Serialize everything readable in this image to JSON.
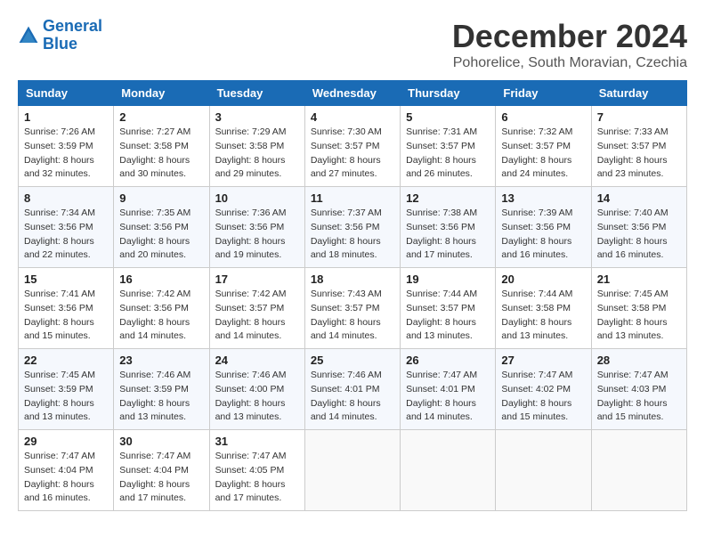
{
  "logo": {
    "line1": "General",
    "line2": "Blue"
  },
  "title": "December 2024",
  "subtitle": "Pohorelice, South Moravian, Czechia",
  "days_of_week": [
    "Sunday",
    "Monday",
    "Tuesday",
    "Wednesday",
    "Thursday",
    "Friday",
    "Saturday"
  ],
  "weeks": [
    [
      {
        "day": "1",
        "rise": "Sunrise: 7:26 AM",
        "set": "Sunset: 3:59 PM",
        "daylight": "Daylight: 8 hours and 32 minutes."
      },
      {
        "day": "2",
        "rise": "Sunrise: 7:27 AM",
        "set": "Sunset: 3:58 PM",
        "daylight": "Daylight: 8 hours and 30 minutes."
      },
      {
        "day": "3",
        "rise": "Sunrise: 7:29 AM",
        "set": "Sunset: 3:58 PM",
        "daylight": "Daylight: 8 hours and 29 minutes."
      },
      {
        "day": "4",
        "rise": "Sunrise: 7:30 AM",
        "set": "Sunset: 3:57 PM",
        "daylight": "Daylight: 8 hours and 27 minutes."
      },
      {
        "day": "5",
        "rise": "Sunrise: 7:31 AM",
        "set": "Sunset: 3:57 PM",
        "daylight": "Daylight: 8 hours and 26 minutes."
      },
      {
        "day": "6",
        "rise": "Sunrise: 7:32 AM",
        "set": "Sunset: 3:57 PM",
        "daylight": "Daylight: 8 hours and 24 minutes."
      },
      {
        "day": "7",
        "rise": "Sunrise: 7:33 AM",
        "set": "Sunset: 3:57 PM",
        "daylight": "Daylight: 8 hours and 23 minutes."
      }
    ],
    [
      {
        "day": "8",
        "rise": "Sunrise: 7:34 AM",
        "set": "Sunset: 3:56 PM",
        "daylight": "Daylight: 8 hours and 22 minutes."
      },
      {
        "day": "9",
        "rise": "Sunrise: 7:35 AM",
        "set": "Sunset: 3:56 PM",
        "daylight": "Daylight: 8 hours and 20 minutes."
      },
      {
        "day": "10",
        "rise": "Sunrise: 7:36 AM",
        "set": "Sunset: 3:56 PM",
        "daylight": "Daylight: 8 hours and 19 minutes."
      },
      {
        "day": "11",
        "rise": "Sunrise: 7:37 AM",
        "set": "Sunset: 3:56 PM",
        "daylight": "Daylight: 8 hours and 18 minutes."
      },
      {
        "day": "12",
        "rise": "Sunrise: 7:38 AM",
        "set": "Sunset: 3:56 PM",
        "daylight": "Daylight: 8 hours and 17 minutes."
      },
      {
        "day": "13",
        "rise": "Sunrise: 7:39 AM",
        "set": "Sunset: 3:56 PM",
        "daylight": "Daylight: 8 hours and 16 minutes."
      },
      {
        "day": "14",
        "rise": "Sunrise: 7:40 AM",
        "set": "Sunset: 3:56 PM",
        "daylight": "Daylight: 8 hours and 16 minutes."
      }
    ],
    [
      {
        "day": "15",
        "rise": "Sunrise: 7:41 AM",
        "set": "Sunset: 3:56 PM",
        "daylight": "Daylight: 8 hours and 15 minutes."
      },
      {
        "day": "16",
        "rise": "Sunrise: 7:42 AM",
        "set": "Sunset: 3:56 PM",
        "daylight": "Daylight: 8 hours and 14 minutes."
      },
      {
        "day": "17",
        "rise": "Sunrise: 7:42 AM",
        "set": "Sunset: 3:57 PM",
        "daylight": "Daylight: 8 hours and 14 minutes."
      },
      {
        "day": "18",
        "rise": "Sunrise: 7:43 AM",
        "set": "Sunset: 3:57 PM",
        "daylight": "Daylight: 8 hours and 14 minutes."
      },
      {
        "day": "19",
        "rise": "Sunrise: 7:44 AM",
        "set": "Sunset: 3:57 PM",
        "daylight": "Daylight: 8 hours and 13 minutes."
      },
      {
        "day": "20",
        "rise": "Sunrise: 7:44 AM",
        "set": "Sunset: 3:58 PM",
        "daylight": "Daylight: 8 hours and 13 minutes."
      },
      {
        "day": "21",
        "rise": "Sunrise: 7:45 AM",
        "set": "Sunset: 3:58 PM",
        "daylight": "Daylight: 8 hours and 13 minutes."
      }
    ],
    [
      {
        "day": "22",
        "rise": "Sunrise: 7:45 AM",
        "set": "Sunset: 3:59 PM",
        "daylight": "Daylight: 8 hours and 13 minutes."
      },
      {
        "day": "23",
        "rise": "Sunrise: 7:46 AM",
        "set": "Sunset: 3:59 PM",
        "daylight": "Daylight: 8 hours and 13 minutes."
      },
      {
        "day": "24",
        "rise": "Sunrise: 7:46 AM",
        "set": "Sunset: 4:00 PM",
        "daylight": "Daylight: 8 hours and 13 minutes."
      },
      {
        "day": "25",
        "rise": "Sunrise: 7:46 AM",
        "set": "Sunset: 4:01 PM",
        "daylight": "Daylight: 8 hours and 14 minutes."
      },
      {
        "day": "26",
        "rise": "Sunrise: 7:47 AM",
        "set": "Sunset: 4:01 PM",
        "daylight": "Daylight: 8 hours and 14 minutes."
      },
      {
        "day": "27",
        "rise": "Sunrise: 7:47 AM",
        "set": "Sunset: 4:02 PM",
        "daylight": "Daylight: 8 hours and 15 minutes."
      },
      {
        "day": "28",
        "rise": "Sunrise: 7:47 AM",
        "set": "Sunset: 4:03 PM",
        "daylight": "Daylight: 8 hours and 15 minutes."
      }
    ],
    [
      {
        "day": "29",
        "rise": "Sunrise: 7:47 AM",
        "set": "Sunset: 4:04 PM",
        "daylight": "Daylight: 8 hours and 16 minutes."
      },
      {
        "day": "30",
        "rise": "Sunrise: 7:47 AM",
        "set": "Sunset: 4:04 PM",
        "daylight": "Daylight: 8 hours and 17 minutes."
      },
      {
        "day": "31",
        "rise": "Sunrise: 7:47 AM",
        "set": "Sunset: 4:05 PM",
        "daylight": "Daylight: 8 hours and 17 minutes."
      },
      null,
      null,
      null,
      null
    ]
  ]
}
